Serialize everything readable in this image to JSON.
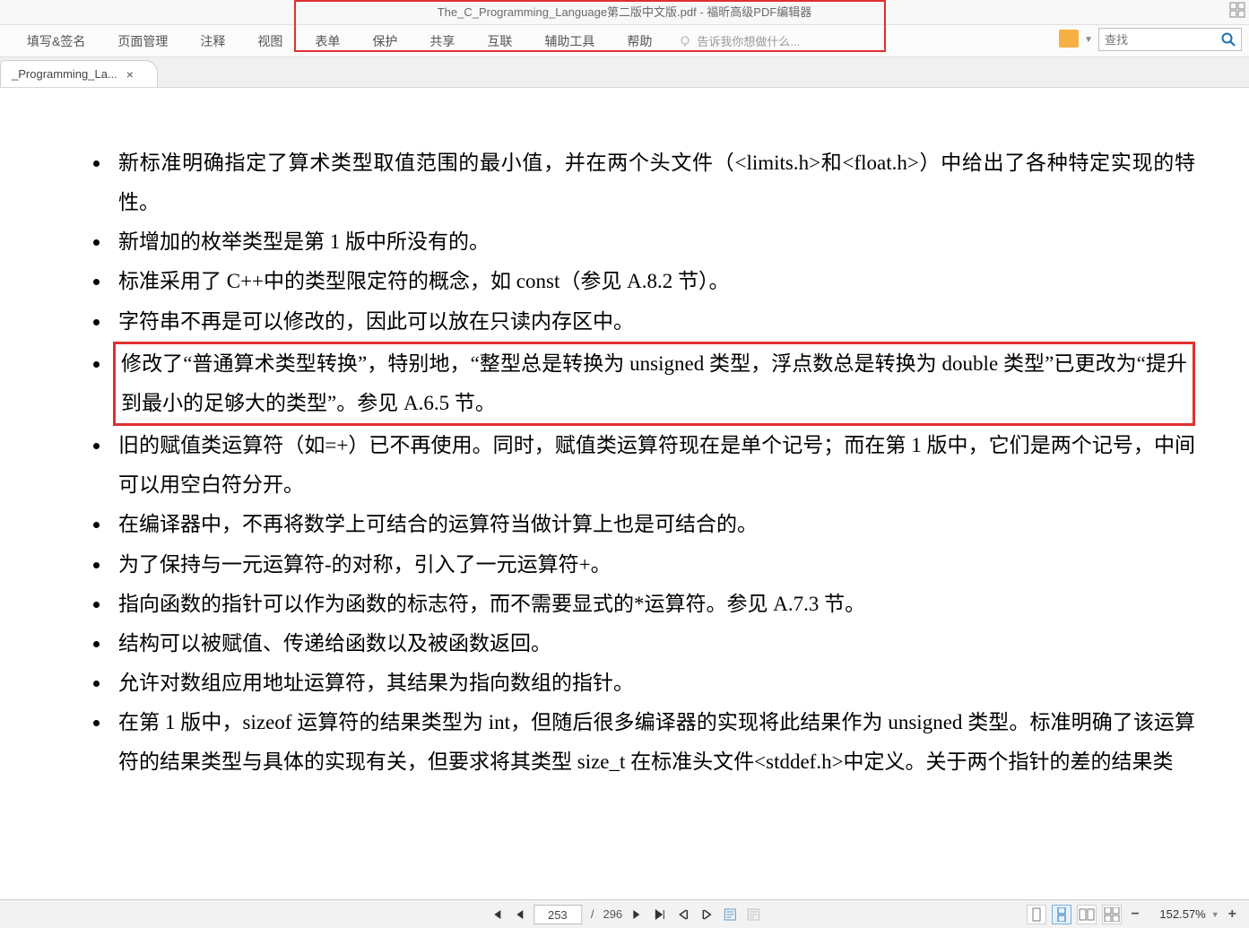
{
  "title": "The_C_Programming_Language第二版中文版.pdf - 福昕高级PDF编辑器",
  "menu": {
    "items": [
      "填写&签名",
      "页面管理",
      "注释",
      "视图",
      "表单",
      "保护",
      "共享",
      "互联",
      "辅助工具",
      "帮助"
    ],
    "tell_me": "告诉我你想做什么..."
  },
  "search": {
    "placeholder": "查找"
  },
  "tab": {
    "label": "_Programming_La...",
    "close": "×"
  },
  "doc": {
    "bullets": [
      "新标准明确指定了算术类型取值范围的最小值，并在两个头文件（<limits.h>和<float.h>）中给出了各种特定实现的特性。",
      "新增加的枚举类型是第 1 版中所没有的。",
      "标准采用了 C++中的类型限定符的概念，如 const（参见 A.8.2 节）。",
      "字符串不再是可以修改的，因此可以放在只读内存区中。",
      "修改了“普通算术类型转换”，特别地，“整型总是转换为 unsigned 类型，浮点数总是转换为 double 类型”已更改为“提升到最小的足够大的类型”。参见 A.6.5 节。",
      "旧的赋值类运算符（如=+）已不再使用。同时，赋值类运算符现在是单个记号；而在第 1 版中，它们是两个记号，中间可以用空白符分开。",
      "在编译器中，不再将数学上可结合的运算符当做计算上也是可结合的。",
      "为了保持与一元运算符-的对称，引入了一元运算符+。",
      "指向函数的指针可以作为函数的标志符，而不需要显式的*运算符。参见 A.7.3 节。",
      "结构可以被赋值、传递给函数以及被函数返回。",
      "允许对数组应用地址运算符，其结果为指向数组的指针。",
      "在第 1 版中，sizeof 运算符的结果类型为 int，但随后很多编译器的实现将此结果作为 unsigned 类型。标准明确了该运算符的结果类型与具体的实现有关，但要求将其类型 size_t 在标准头文件<stddef.h>中定义。关于两个指针的差的结果类"
    ],
    "highlight_index": 4
  },
  "status": {
    "page_current": "253",
    "page_total": "296",
    "zoom": "152.57%"
  }
}
